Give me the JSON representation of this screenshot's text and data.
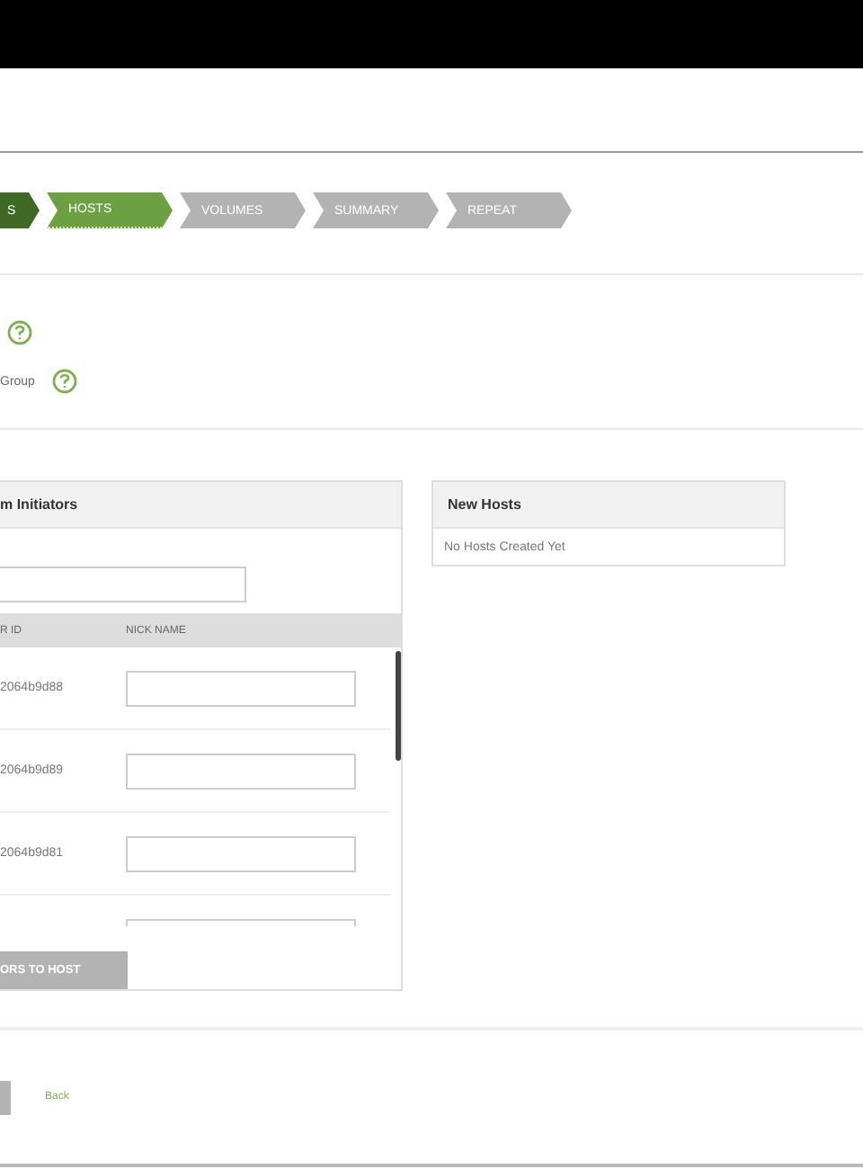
{
  "steps": [
    {
      "label": "S",
      "completed": true,
      "selected": false
    },
    {
      "label": "HOSTS",
      "completed": false,
      "selected": true
    },
    {
      "label": "VOLUMES",
      "completed": false,
      "selected": false
    },
    {
      "label": "SUMMARY",
      "completed": false,
      "selected": false
    },
    {
      "label": "REPEAT",
      "completed": false,
      "selected": false
    }
  ],
  "options": [
    {
      "kind": "help_only"
    },
    {
      "kind": "labeled",
      "label": "Group"
    }
  ],
  "initiators": {
    "title": "m Initiators",
    "columns": [
      "R ID",
      "NICK NAME"
    ],
    "rows": [
      {
        "kind": "entry",
        "id": "2064b9d88"
      },
      {
        "kind": "entry",
        "id": "2064b9d89"
      },
      {
        "kind": "entry",
        "id": "2064b9d81"
      },
      {
        "kind": "cut_off"
      }
    ],
    "add_button": "ORS TO HOST"
  },
  "new_hosts": {
    "title": "New Hosts",
    "empty": "No Hosts Created Yet"
  },
  "footer": {
    "back": "Back"
  }
}
